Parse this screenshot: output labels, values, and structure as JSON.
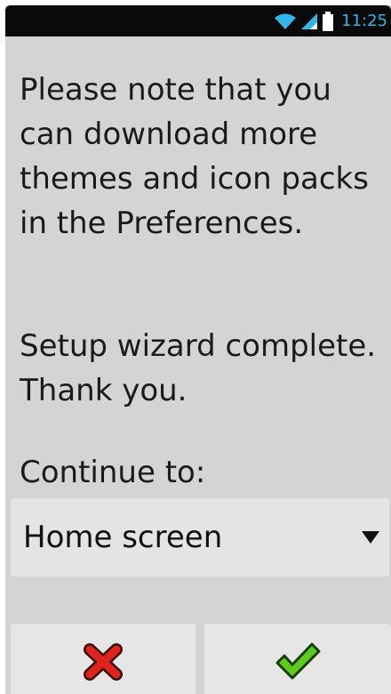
{
  "status_bar": {
    "time": "11:25",
    "icons": [
      "wifi-icon",
      "signal-icon",
      "battery-icon"
    ]
  },
  "message": {
    "line1": "Please note that you can download more themes and icon packs in the Preferences.",
    "line2": "Setup wizard complete. Thank you."
  },
  "continue": {
    "label": "Continue to:",
    "selected": "Home screen"
  },
  "buttons": {
    "cancel_icon": "red-x-icon",
    "confirm_icon": "green-check-icon"
  },
  "colors": {
    "background": "#d4d4d4",
    "status_bar": "#0a0a0a",
    "clock": "#33b5e5",
    "cancel": "#e0241b",
    "confirm": "#5ecb1f"
  }
}
